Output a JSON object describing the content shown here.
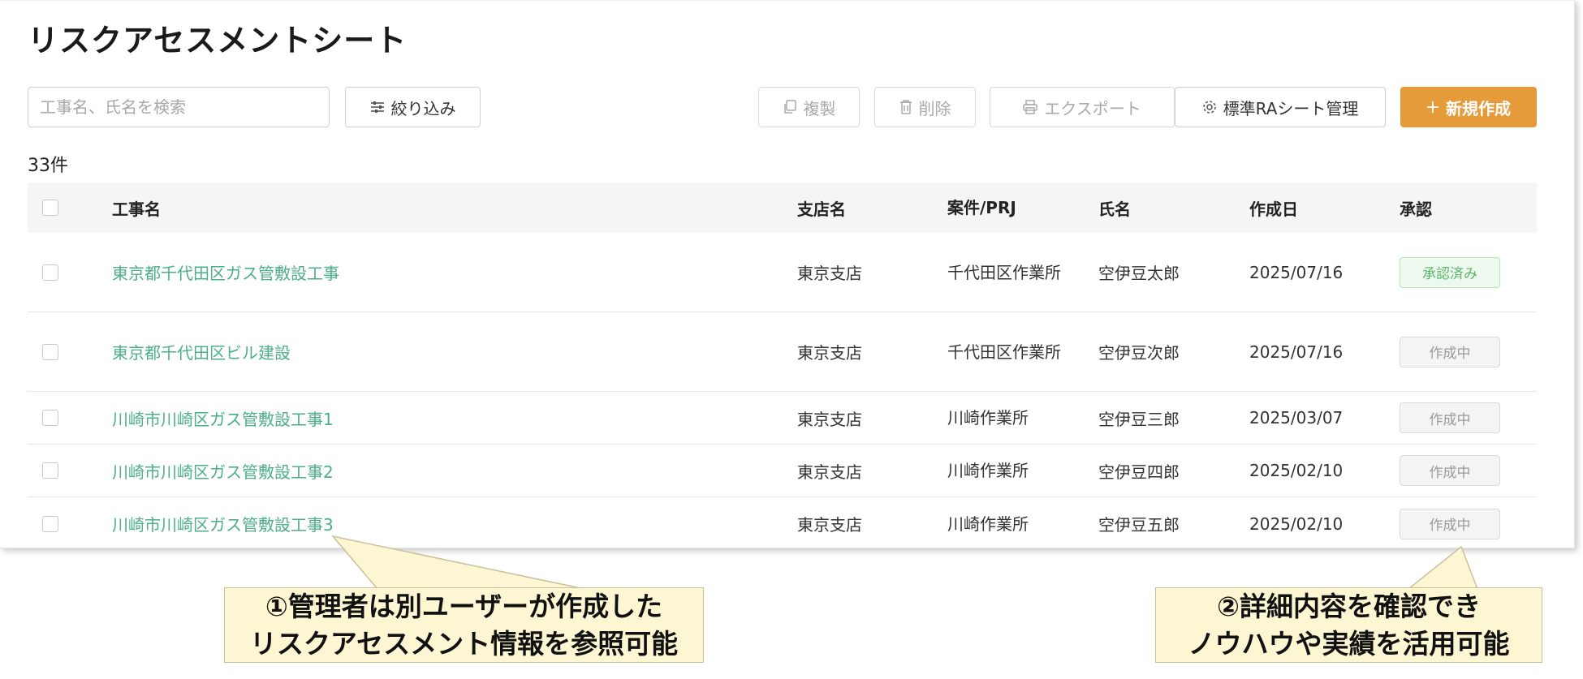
{
  "page": {
    "title": "リスクアセスメントシート",
    "count": "33件"
  },
  "toolbar": {
    "search_placeholder": "工事名、氏名を検索",
    "filter_label": "絞り込み",
    "copy_label": "複製",
    "delete_label": "削除",
    "export_label": "エクスポート",
    "std_label": "標準RAシート管理",
    "new_label": "新規作成",
    "icons": {
      "filter": "sliders-icon",
      "copy": "copy-icon",
      "delete": "trash-icon",
      "export": "printer-icon",
      "std": "gear-icon",
      "new": "plus-icon"
    }
  },
  "table": {
    "headers": {
      "name": "工事名",
      "branch": "支店名",
      "prj": "案件/PRJ",
      "person": "氏名",
      "date": "作成日",
      "approval": "承認"
    },
    "rows": [
      {
        "name": "東京都千代田区ガス管敷設工事",
        "branch": "東京支店",
        "prj": "千代田区作業所",
        "person": "空伊豆太郎",
        "date": "2025/07/16",
        "approval": "承認済み",
        "status": "done"
      },
      {
        "name": "東京都千代田区ビル建設",
        "branch": "東京支店",
        "prj": "千代田区作業所",
        "person": "空伊豆次郎",
        "date": "2025/07/16",
        "approval": "作成中",
        "status": "wip"
      },
      {
        "name": "川崎市川崎区ガス管敷設工事1",
        "branch": "東京支店",
        "prj": "川崎作業所",
        "person": "空伊豆三郎",
        "date": "2025/03/07",
        "approval": "作成中",
        "status": "wip"
      },
      {
        "name": "川崎市川崎区ガス管敷設工事2",
        "branch": "東京支店",
        "prj": "川崎作業所",
        "person": "空伊豆四郎",
        "date": "2025/02/10",
        "approval": "作成中",
        "status": "wip"
      },
      {
        "name": "川崎市川崎区ガス管敷設工事3",
        "branch": "東京支店",
        "prj": "川崎作業所",
        "person": "空伊豆五郎",
        "date": "2025/02/10",
        "approval": "作成中",
        "status": "wip"
      }
    ]
  },
  "callouts": [
    {
      "line1": "①管理者は別ユーザーが作成した",
      "line2": "リスクアセスメント情報を参照可能"
    },
    {
      "line1": "②詳細内容を確認でき",
      "line2": "ノウハウや実績を活用可能"
    }
  ],
  "colors": {
    "accent": "#e69b3a",
    "link": "#4caf88",
    "approved": "#59b668",
    "callout_bg": "#fdf6d3"
  }
}
